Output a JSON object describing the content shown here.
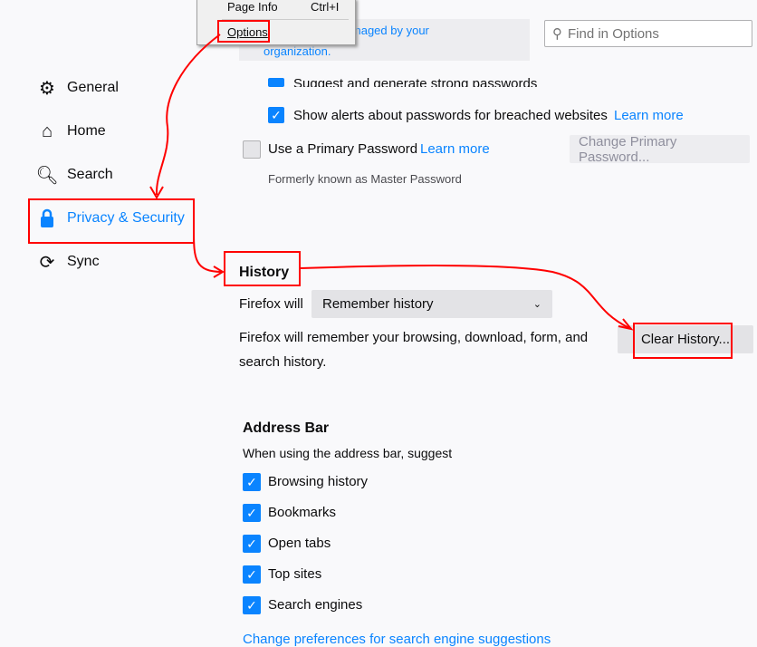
{
  "context_menu": {
    "items": [
      {
        "label": "Page Info",
        "shortcut": "Ctrl+I"
      },
      {
        "label": "Options"
      }
    ]
  },
  "managed_notice": "Your browser is being managed by your organization.",
  "managed_visible": "being managed by your",
  "managed_line2": "organization.",
  "search": {
    "placeholder": "Find in Options",
    "icon": "search-icon"
  },
  "sidebar": {
    "items": [
      {
        "label": "General",
        "icon": "gear-icon"
      },
      {
        "label": "Home",
        "icon": "home-icon"
      },
      {
        "label": "Search",
        "icon": "search-icon"
      },
      {
        "label": "Privacy & Security",
        "icon": "lock-icon",
        "selected": true
      },
      {
        "label": "Sync",
        "icon": "sync-icon"
      }
    ]
  },
  "passwords": {
    "suggest": "Suggest and generate strong passwords",
    "alerts": "Show alerts about passwords for breached websites",
    "learn_more": "Learn more",
    "primary": "Use a Primary Password",
    "primary_learn": "Learn more",
    "change_primary": "Change Primary Password...",
    "formerly": "Formerly known as Master Password"
  },
  "history": {
    "title": "History",
    "firefox_will": "Firefox will",
    "select_value": "Remember history",
    "description1": "Firefox will remember your browsing, download, form, and",
    "description2": "search history.",
    "clear_button": "Clear History..."
  },
  "address_bar": {
    "title": "Address Bar",
    "subtitle": "When using the address bar, suggest",
    "options": [
      {
        "label": "Browsing history",
        "checked": true
      },
      {
        "label": "Bookmarks",
        "checked": true
      },
      {
        "label": "Open tabs",
        "checked": true
      },
      {
        "label": "Top sites",
        "checked": true
      },
      {
        "label": "Search engines",
        "checked": true
      }
    ],
    "link_partial": "Change preferences for search engine suggestions"
  },
  "colors": {
    "accent": "#0a84ff",
    "annotation": "#ff0000"
  }
}
